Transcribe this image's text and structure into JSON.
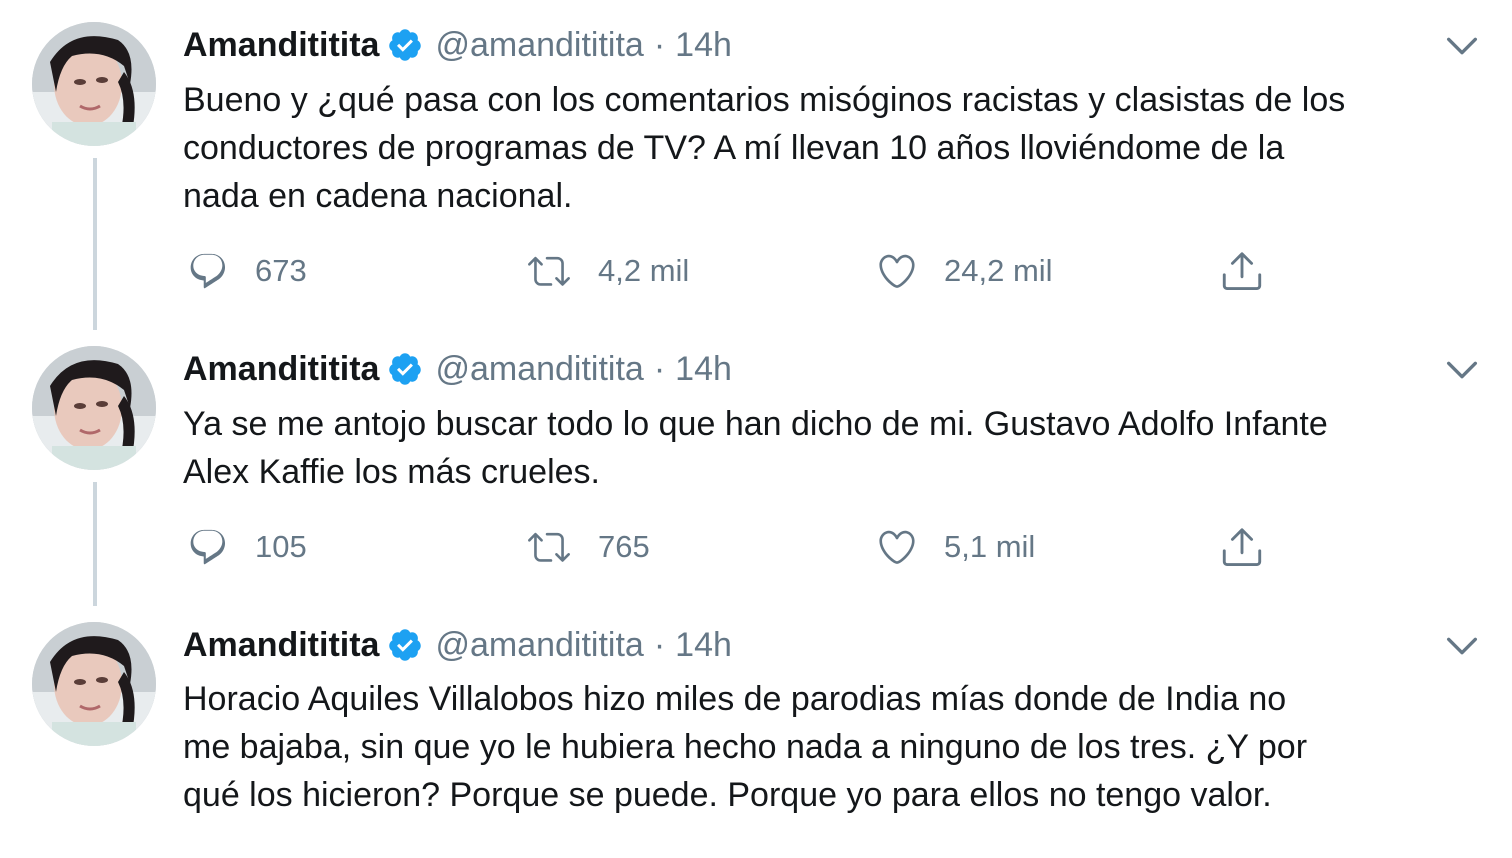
{
  "colors": {
    "text": "#14171a",
    "secondary": "#657786",
    "verified": "#1da1f2",
    "thread_line": "#ccd6dd"
  },
  "icons": {
    "verified": "verified-badge-icon",
    "caret": "chevron-down-icon",
    "reply": "reply-icon",
    "retweet": "retweet-icon",
    "like": "heart-icon",
    "share": "share-icon"
  },
  "tweets": [
    {
      "name": "Amandititita",
      "handle": "@amandititita",
      "separator": "·",
      "time": "14h",
      "text": "Bueno y ¿qué pasa con los comentarios misóginos racistas y clasistas de los\nconductores de programas de TV? A mí llevan 10 años lloviéndome de la\nnada en cadena nacional.",
      "replies": "673",
      "retweets": "4,2 mil",
      "likes": "24,2 mil"
    },
    {
      "name": "Amandititita",
      "handle": "@amandititita",
      "separator": "·",
      "time": "14h",
      "text": "Ya se me antojo buscar todo lo que han dicho de mi. Gustavo Adolfo Infante\nAlex Kaffie los más crueles.",
      "replies": "105",
      "retweets": "765",
      "likes": "5,1 mil"
    },
    {
      "name": "Amandititita",
      "handle": "@amandititita",
      "separator": "·",
      "time": "14h",
      "text": "Horacio Aquiles Villalobos hizo miles de parodias mías donde de India no\nme bajaba, sin que yo le hubiera hecho nada a ninguno de los tres. ¿Y por\nqué los hicieron? Porque se puede. Porque yo para ellos no tengo valor."
    }
  ]
}
